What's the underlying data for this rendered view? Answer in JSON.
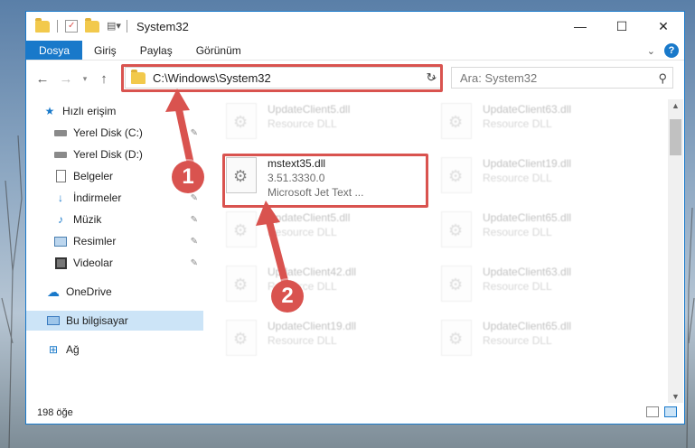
{
  "window": {
    "title": "System32",
    "controls": {
      "minimize": "—",
      "maximize": "☐",
      "close": "✕"
    }
  },
  "ribbon": {
    "tabs": [
      "Dosya",
      "Giriş",
      "Paylaş",
      "Görünüm"
    ],
    "accent": "#1979ca"
  },
  "nav": {
    "address": "C:\\Windows\\System32",
    "search_placeholder": "Ara: System32"
  },
  "sidebar": {
    "items": [
      {
        "label": "Hızlı erişim",
        "icon": "star-icon"
      },
      {
        "label": "Yerel Disk (C:)",
        "icon": "drive-icon"
      },
      {
        "label": "Yerel Disk (D:)",
        "icon": "drive-icon"
      },
      {
        "label": "Belgeler",
        "icon": "documents-icon"
      },
      {
        "label": "İndirmeler",
        "icon": "download-icon"
      },
      {
        "label": "Müzik",
        "icon": "music-icon"
      },
      {
        "label": "Resimler",
        "icon": "pictures-icon"
      },
      {
        "label": "Videolar",
        "icon": "video-icon"
      },
      {
        "label": "OneDrive",
        "icon": "cloud-icon"
      },
      {
        "label": "Bu bilgisayar",
        "icon": "computer-icon"
      },
      {
        "label": "Ağ",
        "icon": "network-icon"
      }
    ]
  },
  "files": {
    "highlighted": {
      "name": "mstext35.dll",
      "version": "3.51.3330.0",
      "description": "Microsoft Jet Text ..."
    },
    "others": [
      {
        "name": "UpdateClient5.dll",
        "type": "Resource DLL"
      },
      {
        "name": "UpdateClient63.dll",
        "type": "Resource DLL"
      },
      {
        "name": "UpdateClient19.dll",
        "type": "Resource DLL"
      },
      {
        "name": "UpdateClient5.dll",
        "type": "Resource DLL"
      },
      {
        "name": "UpdateClient65.dll",
        "type": "Resource DLL"
      },
      {
        "name": "UpdateClient42.dll",
        "type": "Resource DLL"
      },
      {
        "name": "UpdateClient63.dll",
        "type": "Resource DLL"
      },
      {
        "name": "UpdateClient19.dll",
        "type": "Resource DLL"
      },
      {
        "name": "UpdateClient65.dll",
        "type": "Resource DLL"
      }
    ]
  },
  "status": {
    "count": "198 öğe"
  },
  "annotations": {
    "step1": "1",
    "step2": "2",
    "color": "#d9534f"
  }
}
